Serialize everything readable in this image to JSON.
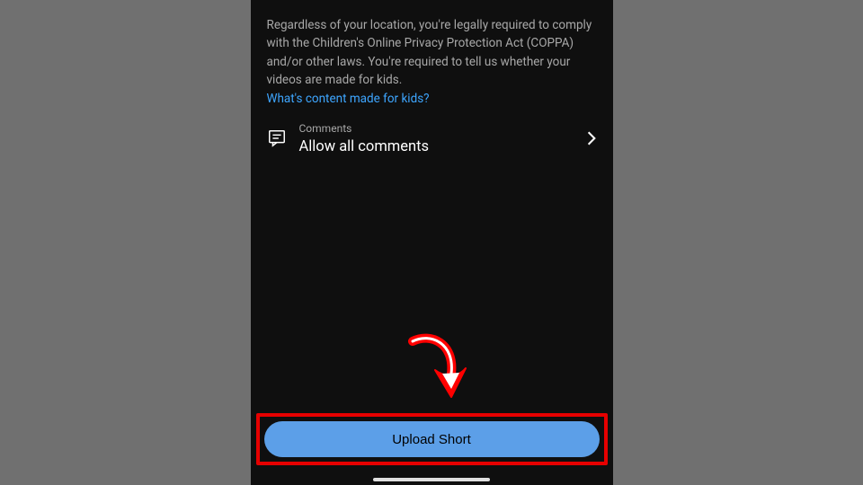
{
  "legal": {
    "text": "Regardless of your location, you're legally required to comply with the Children's Online Privacy Protection Act (COPPA) and/or other laws. You're required to tell us whether your videos are made for kids.",
    "link": "What's content made for kids?"
  },
  "comments": {
    "label": "Comments",
    "value": "Allow all comments"
  },
  "upload": {
    "label": "Upload Short"
  }
}
